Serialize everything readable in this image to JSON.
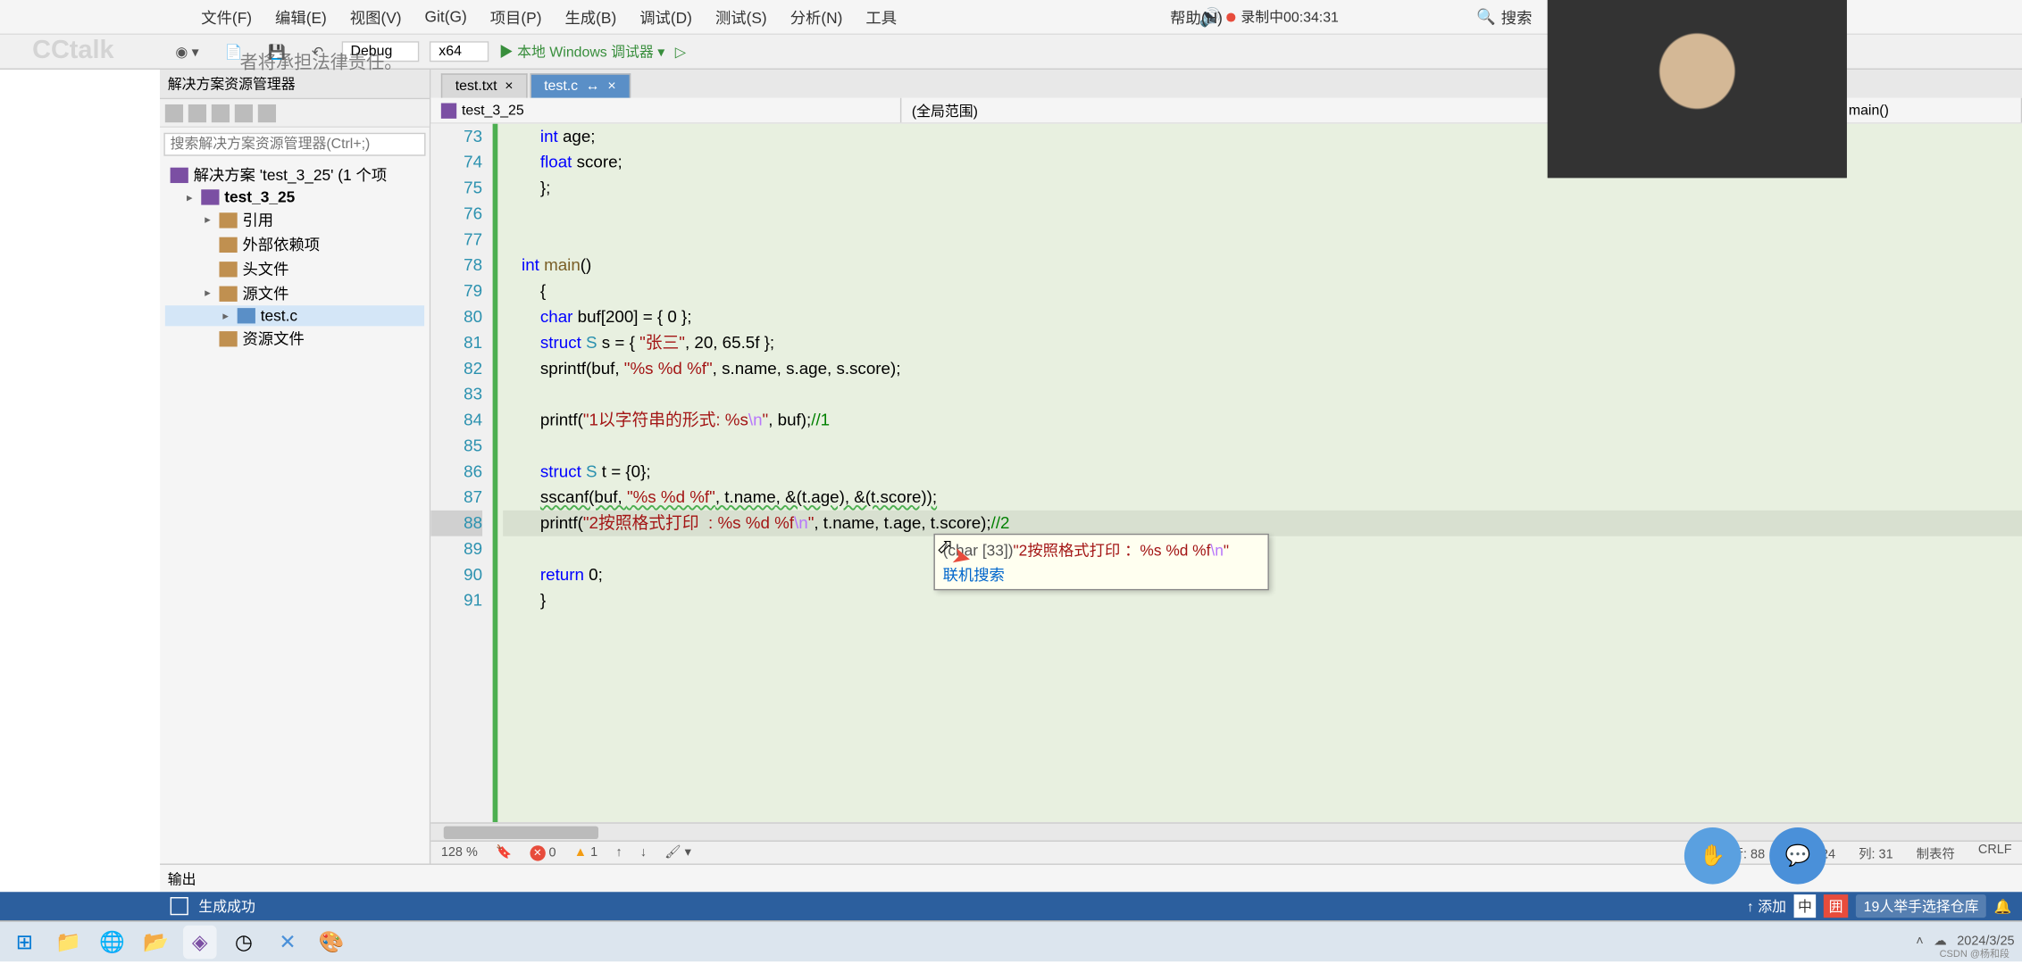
{
  "watermark": "CCtalk",
  "watermark_text": "者将承担法律责任。",
  "menus": [
    "文件(F)",
    "编辑(E)",
    "视图(V)",
    "Git(G)",
    "项目(P)",
    "生成(B)",
    "调试(D)",
    "测试(S)",
    "分析(N)",
    "工具",
    "帮助(H)"
  ],
  "recording": "录制中00:34:31",
  "search_label": "搜索",
  "tab_title": "test_3_25",
  "toolbar": {
    "config": "Debug",
    "platform": "x64",
    "debug_target": "本地 Windows 调试器"
  },
  "solution": {
    "panel_title": "解决方案资源管理器",
    "search_placeholder": "搜索解决方案资源管理器(Ctrl+;)",
    "root": "解决方案 'test_3_25' (1 个项",
    "project": "test_3_25",
    "refs": "引用",
    "ext_deps": "外部依赖项",
    "headers": "头文件",
    "sources": "源文件",
    "file": "test.c",
    "resources": "资源文件"
  },
  "tabs": {
    "inactive": "test.txt",
    "active": "test.c"
  },
  "breadcrumb": {
    "project": "test_3_25",
    "scope": "(全局范围)",
    "func": "main()"
  },
  "code": {
    "line_start": 73,
    "current_line": 88,
    "lines": [
      {
        "n": 73,
        "t": "        int age;",
        "parts": [
          {
            "cls": "kw",
            "t": "int"
          },
          {
            "t": " age;"
          }
        ],
        "indent": 8
      },
      {
        "n": 74,
        "t": "        float score;",
        "parts": [
          {
            "cls": "kw",
            "t": "float"
          },
          {
            "t": " score;"
          }
        ],
        "indent": 8
      },
      {
        "n": 75,
        "t": "    };",
        "indent": 4
      },
      {
        "n": 76,
        "t": "",
        "indent": 0
      },
      {
        "n": 77,
        "t": "",
        "indent": 0
      },
      {
        "n": 78,
        "t": "    int main()",
        "parts": [
          {
            "cls": "kw",
            "t": "int"
          },
          {
            "t": " "
          },
          {
            "cls": "fn",
            "t": "main"
          },
          {
            "t": "()"
          }
        ],
        "indent": 4
      },
      {
        "n": 79,
        "t": "    {",
        "indent": 4
      },
      {
        "n": 80,
        "t": "        char buf[200] = { 0 };",
        "parts": [
          {
            "cls": "kw",
            "t": "char"
          },
          {
            "t": " buf[200] = { 0 };"
          }
        ],
        "indent": 8
      },
      {
        "n": 81,
        "t": "",
        "raw": true,
        "html": "        <span class=\"kw\">struct</span> <span class=\"type\">S</span> s = { <span class=\"str\">\"张三\"</span>, 20, 65.5f };"
      },
      {
        "n": 82,
        "raw": true,
        "html": "        sprintf(buf, <span class=\"str\">\"%s %d %f\"</span>, s.name, s.age, s.score);"
      },
      {
        "n": 83,
        "t": ""
      },
      {
        "n": 84,
        "raw": true,
        "html": "        printf(<span class=\"str\">\"1以字符串的形式: %s<span class=\"esc\">\\n</span>\"</span>, buf);<span class=\"cmt\">//1</span>"
      },
      {
        "n": 85,
        "t": ""
      },
      {
        "n": 86,
        "raw": true,
        "html": "        <span class=\"kw\">struct</span> <span class=\"type\">S</span> t = {0};"
      },
      {
        "n": 87,
        "raw": true,
        "html": "        <span class=\"sscanf-wave\">sscanf(buf, <span class=\"str\">\"%s %d %f\"</span>, t.name, &amp;(t.age), &amp;(t.score));</span>"
      },
      {
        "n": 88,
        "raw": true,
        "html": "        printf(<span class=\"str\">\"2按照格式打印  : %s %d %f<span class=\"esc\">\\n</span>\"</span>, t.name, t.age, t.score);<span class=\"cmt\">//2</span>",
        "current": true
      },
      {
        "n": 89,
        "t": ""
      },
      {
        "n": 90,
        "raw": true,
        "html": "        <span class=\"kw\">return</span> 0;"
      },
      {
        "n": 91,
        "t": "    }",
        "indent": 4
      }
    ]
  },
  "tooltip": {
    "type": "(char [33])",
    "value": "\"2按照格式打印  ：%s %d %f",
    "esc": "\\n",
    "end": "\"",
    "link": "联机搜索"
  },
  "code_status": {
    "zoom": "128 %",
    "errors": "0",
    "warnings": "1",
    "line": "行: 88",
    "char": "字符: 24",
    "col": "列: 31",
    "tabs": "制表符",
    "crlf": "CRLF"
  },
  "output_label": "输出",
  "statusbar": {
    "build": "生成成功",
    "add": "添加",
    "notif": "19人举手选择仓库"
  },
  "csdn": "CSDN @杨和段",
  "date": "2024/3/25"
}
